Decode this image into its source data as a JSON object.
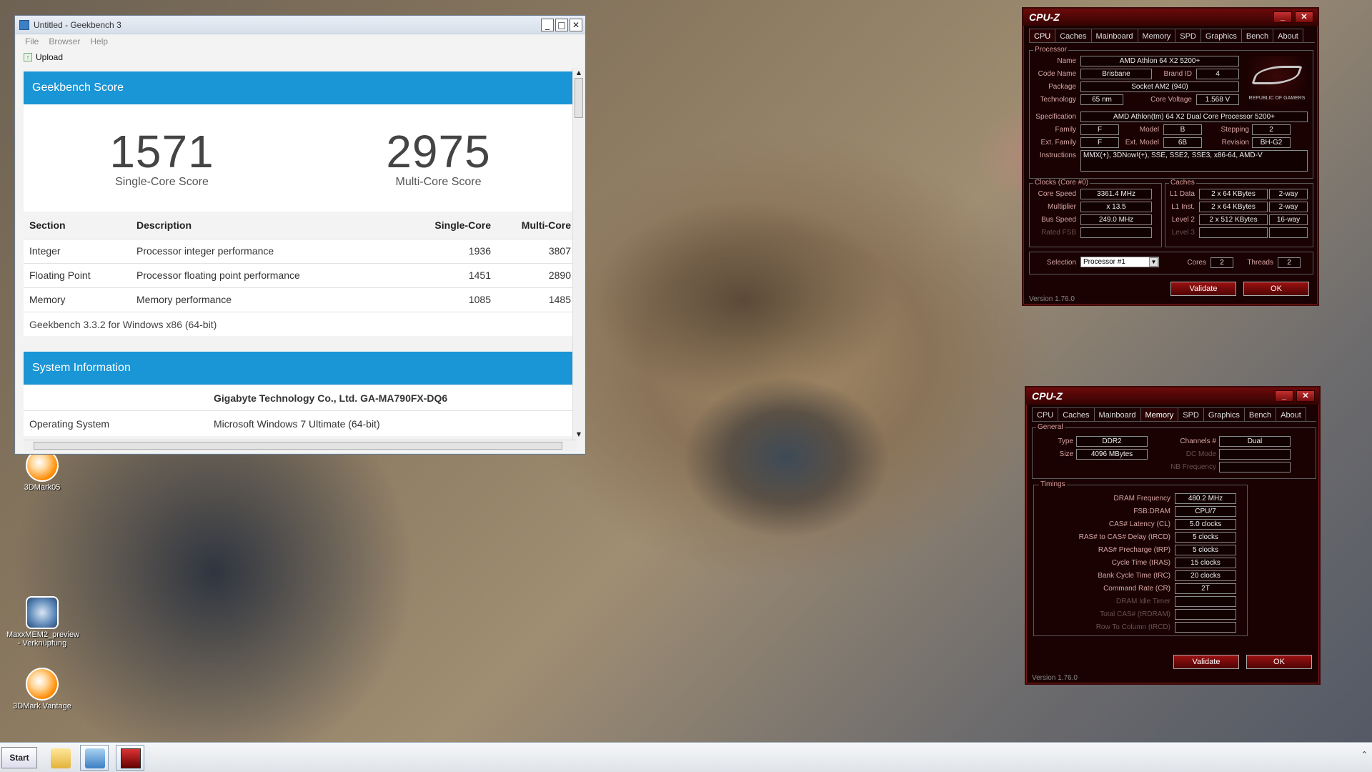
{
  "geekbench": {
    "title": "Untitled - Geekbench 3",
    "window_buttons": {
      "minimize": "_",
      "maximize": "□",
      "close": "✕"
    },
    "menu": [
      "File",
      "Browser",
      "Help"
    ],
    "upload_label": "Upload",
    "score_header": "Geekbench Score",
    "single_score": "1571",
    "single_label": "Single-Core Score",
    "multi_score": "2975",
    "multi_label": "Multi-Core Score",
    "table_headers": {
      "section": "Section",
      "description": "Description",
      "single": "Single-Core",
      "multi": "Multi-Core"
    },
    "rows": [
      {
        "section": "Integer",
        "description": "Processor integer performance",
        "single": "1936",
        "multi": "3807"
      },
      {
        "section": "Floating Point",
        "description": "Processor floating point performance",
        "single": "1451",
        "multi": "2890"
      },
      {
        "section": "Memory",
        "description": "Memory performance",
        "single": "1085",
        "multi": "1485"
      }
    ],
    "footer": "Geekbench 3.3.2 for Windows x86 (64-bit)",
    "sysinfo_header": "System Information",
    "sysinfo": [
      {
        "key": "",
        "value": "Gigabyte Technology Co., Ltd. GA-MA790FX-DQ6"
      },
      {
        "key": "Operating System",
        "value": "Microsoft Windows 7 Ultimate (64-bit)"
      }
    ]
  },
  "cpuz_common": {
    "title": "CPU-Z",
    "tabs": [
      "CPU",
      "Caches",
      "Mainboard",
      "Memory",
      "SPD",
      "Graphics",
      "Bench",
      "About"
    ],
    "validate": "Validate",
    "ok": "OK",
    "version": "Version 1.76.0",
    "min": "_",
    "close": "✕"
  },
  "cpuz_cpu": {
    "processor_label": "Processor",
    "labels": {
      "name": "Name",
      "code_name": "Code Name",
      "brand_id": "Brand ID",
      "package": "Package",
      "technology": "Technology",
      "core_voltage": "Core Voltage",
      "specification": "Specification",
      "family": "Family",
      "model": "Model",
      "stepping": "Stepping",
      "ext_family": "Ext. Family",
      "ext_model": "Ext. Model",
      "revision": "Revision",
      "instructions": "Instructions"
    },
    "name": "AMD Athlon 64 X2 5200+",
    "code_name": "Brisbane",
    "brand_id": "4",
    "package": "Socket AM2 (940)",
    "technology": "65 nm",
    "core_voltage": "1.568 V",
    "specification": "AMD Athlon(tm) 64 X2 Dual Core Processor 5200+",
    "family": "F",
    "model": "B",
    "stepping": "2",
    "ext_family": "F",
    "ext_model": "6B",
    "revision": "BH-G2",
    "instructions": "MMX(+), 3DNow!(+), SSE, SSE2, SSE3, x86-64, AMD-V",
    "rog_text": "REPUBLIC OF GAMERS",
    "clocks_label": "Clocks (Core #0)",
    "clock_labels": {
      "core_speed": "Core Speed",
      "multiplier": "Multiplier",
      "bus_speed": "Bus Speed",
      "rated_fsb": "Rated FSB"
    },
    "core_speed": "3361.4 MHz",
    "multiplier": "x 13.5",
    "bus_speed": "249.0 MHz",
    "caches_label": "Caches",
    "cache_labels": {
      "l1d": "L1 Data",
      "l1i": "L1 Inst.",
      "l2": "Level 2",
      "l3": "Level 3"
    },
    "l1d_size": "2 x 64 KBytes",
    "l1d_way": "2-way",
    "l1i_size": "2 x 64 KBytes",
    "l1i_way": "2-way",
    "l2_size": "2 x 512 KBytes",
    "l2_way": "16-way",
    "selection_label": "Selection",
    "selection": "Processor #1",
    "cores_label": "Cores",
    "cores": "2",
    "threads_label": "Threads",
    "threads": "2"
  },
  "cpuz_mem": {
    "general_label": "General",
    "labels": {
      "type": "Type",
      "size": "Size",
      "channels": "Channels #",
      "dc_mode": "DC Mode",
      "nb_freq": "NB Frequency"
    },
    "type": "DDR2",
    "size": "4096 MBytes",
    "channels": "Dual",
    "timings_label": "Timings",
    "timings": [
      {
        "label": "DRAM Frequency",
        "value": "480.2 MHz",
        "dim": false
      },
      {
        "label": "FSB:DRAM",
        "value": "CPU/7",
        "dim": false
      },
      {
        "label": "CAS# Latency (CL)",
        "value": "5.0 clocks",
        "dim": false
      },
      {
        "label": "RAS# to CAS# Delay (tRCD)",
        "value": "5 clocks",
        "dim": false
      },
      {
        "label": "RAS# Precharge (tRP)",
        "value": "5 clocks",
        "dim": false
      },
      {
        "label": "Cycle Time (tRAS)",
        "value": "15 clocks",
        "dim": false
      },
      {
        "label": "Bank Cycle Time (tRC)",
        "value": "20 clocks",
        "dim": false
      },
      {
        "label": "Command Rate (CR)",
        "value": "2T",
        "dim": false
      },
      {
        "label": "DRAM Idle Timer",
        "value": "",
        "dim": true
      },
      {
        "label": "Total CAS# (tRDRAM)",
        "value": "",
        "dim": true
      },
      {
        "label": "Row To Column (tRCD)",
        "value": "",
        "dim": true
      }
    ]
  },
  "desktop_icons": [
    {
      "label": "3DMark05",
      "icon": "3dmark-icon"
    },
    {
      "label": "MaxxMEM2_preview - Verknüpfung",
      "icon": "maxxmem-icon"
    },
    {
      "label": "3DMark Vantage",
      "icon": "3dmark-icon"
    }
  ],
  "taskbar": {
    "start": "Start",
    "tray": "⌃"
  }
}
